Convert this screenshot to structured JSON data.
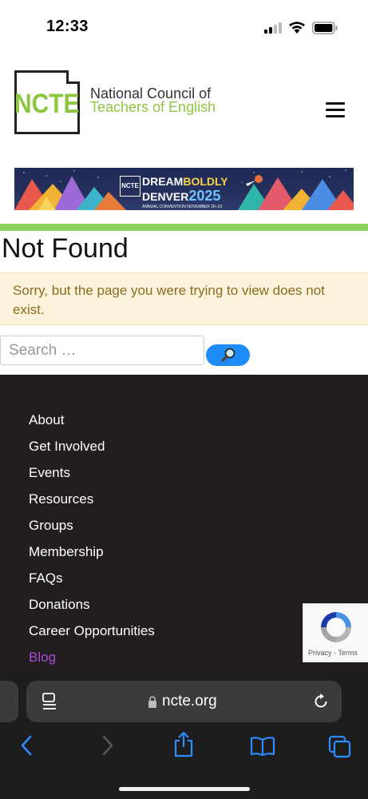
{
  "status_bar": {
    "time": "12:33"
  },
  "header": {
    "logo_text": "NCTE",
    "org_name_line1": "National Council of",
    "org_name_line2": "Teachers of English"
  },
  "banner": {
    "logo_text": "NCTE",
    "dream": "DREAM",
    "boldly": "BOLDLY",
    "denver": "DENVER",
    "year": "2025",
    "subtitle": "ANNUAL CONVENTION NOVEMBER 20–23"
  },
  "main": {
    "title": "Not Found",
    "alert": "Sorry, but the page you were trying to view does not exist.",
    "search_placeholder": "Search …"
  },
  "footer": {
    "links": [
      "About",
      "Get Involved",
      "Events",
      "Resources",
      "Groups",
      "Membership",
      "FAQs",
      "Donations",
      "Career Opportunities",
      "Blog"
    ]
  },
  "recaptcha": {
    "terms": "Privacy - Terms"
  },
  "browser": {
    "url": "ncte.org"
  },
  "colors": {
    "brand_green": "#8dc63f",
    "alert_bg": "#fcf3dc",
    "alert_text": "#8a6a1e",
    "footer_bg": "#221e1f",
    "blog_link": "#a94bd9",
    "search_button": "#1d8cf7",
    "ios_blue": "#2f8cff"
  }
}
